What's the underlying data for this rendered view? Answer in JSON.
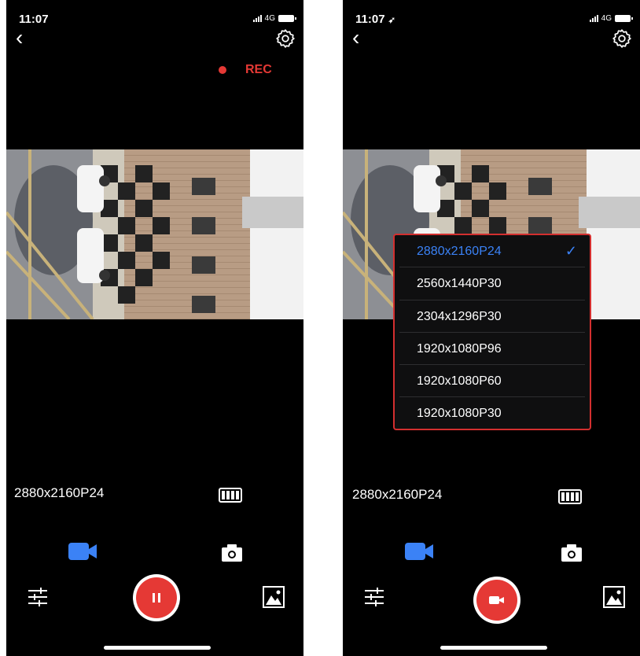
{
  "screens": [
    {
      "status_time": "11:07",
      "network": "4G",
      "rec_label": "REC",
      "current_resolution": "2880x2160P24",
      "mode": "video",
      "shutter_state": "recording"
    },
    {
      "status_time": "11:07",
      "network": "4G",
      "current_resolution": "2880x2160P24",
      "mode": "video",
      "shutter_state": "idle",
      "resolution_menu": {
        "selected_index": 0,
        "options": [
          "2880x2160P24",
          "2560x1440P30",
          "2304x1296P30",
          "1920x1080P96",
          "1920x1080P60",
          "1920x1080P30"
        ]
      }
    }
  ],
  "colors": {
    "accent_blue": "#3b82f6",
    "record_red": "#e53935",
    "menu_border": "#d32f2f",
    "background": "#000000"
  },
  "icons": {
    "back": "chevron-left-icon",
    "settings": "gear-icon",
    "video_mode": "video-camera-icon",
    "photo_mode": "camera-icon",
    "adjust": "sliders-icon",
    "gallery": "image-icon",
    "card_battery": "battery-icon"
  }
}
